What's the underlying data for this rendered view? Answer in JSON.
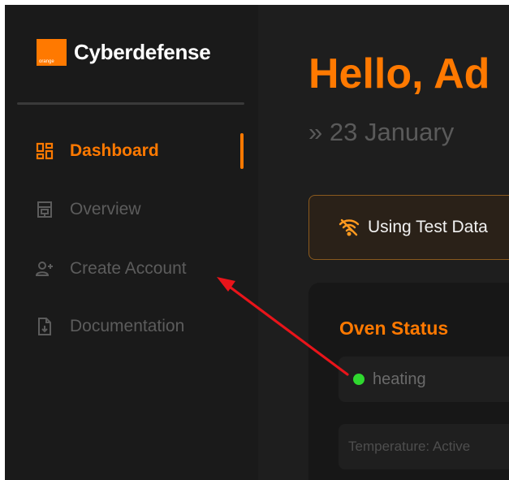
{
  "brand": {
    "logo_text": "orange",
    "name": "Cyberdefense",
    "color": "#ff7900"
  },
  "sidebar": {
    "items": [
      {
        "label": "Dashboard",
        "icon": "dashboard-grid-icon",
        "active": true
      },
      {
        "label": "Overview",
        "icon": "building-icon",
        "active": false
      },
      {
        "label": "Create Account",
        "icon": "add-user-icon",
        "active": false
      },
      {
        "label": "Documentation",
        "icon": "document-download-icon",
        "active": false
      }
    ]
  },
  "main": {
    "greeting": "Hello, Ad",
    "date": "» 23 January",
    "banner": {
      "icon": "wifi-off-icon",
      "text": "Using Test Data"
    },
    "oven_card": {
      "title": "Oven Status",
      "status": "heating",
      "status_color": "#2fd82f",
      "temperature_text": "Temperature: Active"
    }
  },
  "annotation": {
    "type": "red-arrow",
    "color": "#e8141a",
    "target": "Create Account"
  }
}
